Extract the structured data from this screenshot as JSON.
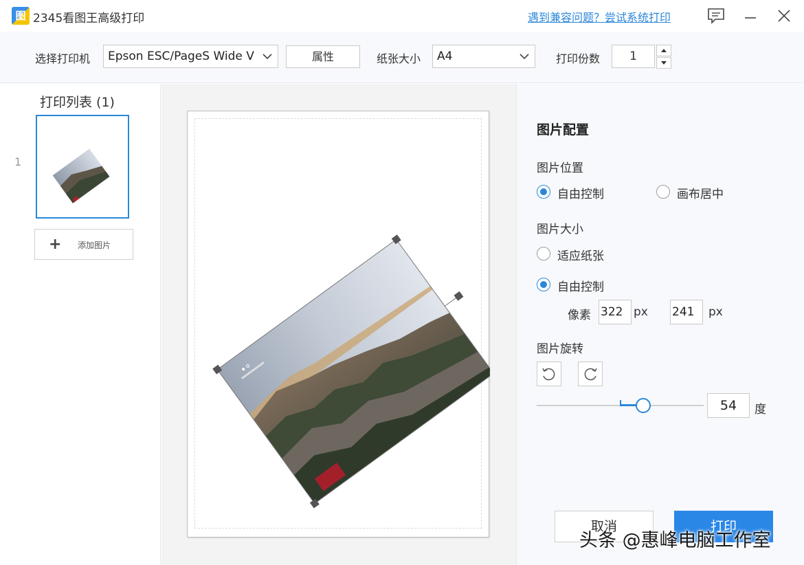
{
  "window": {
    "title": "2345看图王高级打印",
    "logo_glyph": "图",
    "compat_link": "遇到兼容问题？尝试系统打印",
    "icons": [
      "feedback-icon",
      "minimize-icon",
      "close-icon"
    ]
  },
  "toolbar": {
    "printer_label": "选择打印机",
    "printer_value": "Epson ESC/PageS Wide V",
    "properties_label": "属性",
    "paper_label": "纸张大小",
    "paper_value": "A4",
    "copies_label": "打印份数",
    "copies_value": "1"
  },
  "print_list": {
    "title": "打印列表 (1)",
    "items": [
      {
        "index": "1"
      }
    ],
    "add_label": "添加图片"
  },
  "image_config": {
    "title": "图片配置",
    "position": {
      "label": "图片位置",
      "options": [
        {
          "label": "自由控制",
          "checked": true
        },
        {
          "label": "画布居中",
          "checked": false
        }
      ]
    },
    "size": {
      "label": "图片大小",
      "options": [
        {
          "label": "适应纸张",
          "checked": false
        },
        {
          "label": "自由控制",
          "checked": true
        }
      ],
      "pixel_label": "像素",
      "width": "322",
      "height": "241",
      "unit": "px"
    },
    "rotation": {
      "label": "图片旋转",
      "angle": "54",
      "unit": "度",
      "slider_fraction": 0.15
    }
  },
  "actions": {
    "cancel_label": "取消",
    "print_label": "打印"
  },
  "watermark": "头条 @惠峰电脑工作室",
  "colors": {
    "accent": "#2b87d9",
    "print_button": "#2b87e6"
  }
}
